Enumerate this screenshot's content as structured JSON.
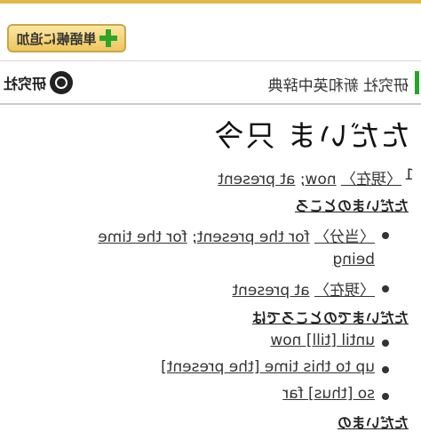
{
  "toolbar": {
    "add_label": "単語帳に追加"
  },
  "dict_header": {
    "title": "研究社 新和英中辞典",
    "publisher": "研究社"
  },
  "entry": {
    "headword": "ただいま 只今",
    "sense1": {
      "number": "1",
      "label": "〈現在〉",
      "translation_1": "now",
      "separator": ";",
      "translation_2": "at present"
    },
    "sub1": {
      "heading": "ただいまのところ",
      "items": [
        {
          "label": "〈当分〉",
          "text_1": "for the present",
          "separator": ";",
          "text_2": "for the time",
          "text_3": "being"
        },
        {
          "label": "〈現在〉",
          "text_1": "at present"
        }
      ]
    },
    "sub2": {
      "heading": "ただいまでのところでは",
      "items": [
        {
          "text_1": "until [till] now"
        },
        {
          "text_1": "up to this time [the present]"
        },
        {
          "text_1": "so [thus] far"
        }
      ]
    },
    "sub3_partial": "ただいまの"
  }
}
